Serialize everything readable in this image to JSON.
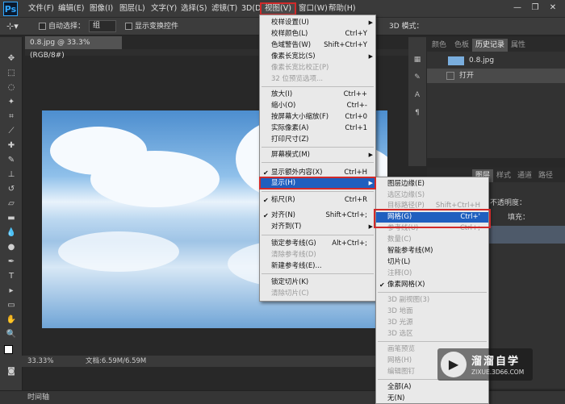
{
  "app": {
    "logo": "Ps"
  },
  "menubar": {
    "items": [
      "文件(F)",
      "编辑(E)",
      "图像(I)",
      "图层(L)",
      "文字(Y)",
      "选择(S)",
      "滤镜(T)",
      "3D(D)",
      "视图(V)",
      "窗口(W)",
      "帮助(H)"
    ]
  },
  "window_controls": {
    "minimize": "—",
    "maximize": "❐",
    "close": "✕"
  },
  "options": {
    "auto_select_label": "自动选择：",
    "auto_select_value": "组",
    "show_transform_label": "显示变换控件",
    "mode_3d_label": "3D 模式："
  },
  "document": {
    "tab_title": "0.8.jpg @ 33.3%(RGB/8#)"
  },
  "status": {
    "zoom": "33.33%",
    "doc_info": "文档:6.59M/6.59M"
  },
  "timeline": {
    "label": "时间轴"
  },
  "right_panel": {
    "top_tabs": [
      "颜色",
      "色板",
      "历史记录",
      "属性"
    ],
    "history": [
      {
        "label": "0.8.jpg"
      },
      {
        "label": "打开"
      }
    ],
    "layer_tabs": [
      "图层",
      "样式",
      "通道",
      "路径"
    ],
    "opacity_label": "不透明度：",
    "fill_label": "填充："
  },
  "view_menu": {
    "items": [
      {
        "label": "校样设置(U)",
        "shortcut": "",
        "submenu": true
      },
      {
        "label": "校样颜色(L)",
        "shortcut": "Ctrl+Y"
      },
      {
        "label": "色域警告(W)",
        "shortcut": "Shift+Ctrl+Y"
      },
      {
        "label": "像素长宽比(S)",
        "shortcut": "",
        "submenu": true
      },
      {
        "label": "像素长宽比校正(P)",
        "shortcut": "",
        "disabled": true
      },
      {
        "label": "32 位预览选项...",
        "shortcut": "",
        "disabled": true
      },
      {
        "label": "放大(I)",
        "shortcut": "Ctrl++"
      },
      {
        "label": "缩小(O)",
        "shortcut": "Ctrl+-"
      },
      {
        "label": "按屏幕大小缩放(F)",
        "shortcut": "Ctrl+0"
      },
      {
        "label": "实际像素(A)",
        "shortcut": "Ctrl+1"
      },
      {
        "label": "打印尺寸(Z)",
        "shortcut": ""
      },
      {
        "label": "屏幕模式(M)",
        "shortcut": "",
        "submenu": true
      },
      {
        "label": "显示额外内容(X)",
        "shortcut": "Ctrl+H",
        "checked": true
      },
      {
        "label": "显示(H)",
        "shortcut": "",
        "submenu": true,
        "highlighted": true
      },
      {
        "label": "标尺(R)",
        "shortcut": "Ctrl+R",
        "checked": true
      },
      {
        "label": "对齐(N)",
        "shortcut": "Shift+Ctrl+;",
        "checked": true
      },
      {
        "label": "对齐到(T)",
        "shortcut": "",
        "submenu": true
      },
      {
        "label": "锁定参考线(G)",
        "shortcut": "Alt+Ctrl+;"
      },
      {
        "label": "清除参考线(D)",
        "shortcut": "",
        "disabled": true
      },
      {
        "label": "新建参考线(E)...",
        "shortcut": ""
      },
      {
        "label": "锁定切片(K)",
        "shortcut": ""
      },
      {
        "label": "清除切片(C)",
        "shortcut": "",
        "disabled": true
      }
    ]
  },
  "show_submenu": {
    "items": [
      {
        "label": "图层边缘(E)",
        "shortcut": ""
      },
      {
        "label": "选区边缘(S)",
        "shortcut": "",
        "disabled": true
      },
      {
        "label": "目标路径(P)",
        "shortcut": "Shift+Ctrl+H",
        "disabled": true
      },
      {
        "label": "网格(G)",
        "shortcut": "Ctrl+'",
        "highlighted": true
      },
      {
        "label": "参考线(U)",
        "shortcut": "Ctrl+;",
        "disabled": true
      },
      {
        "label": "数量(C)",
        "shortcut": "",
        "disabled": true
      },
      {
        "label": "智能参考线(M)",
        "shortcut": ""
      },
      {
        "label": "切片(L)",
        "shortcut": ""
      },
      {
        "label": "注释(O)",
        "shortcut": "",
        "disabled": true
      },
      {
        "label": "像素网格(X)",
        "shortcut": "",
        "checked": true
      },
      {
        "label": "3D 副视图(3)",
        "shortcut": "",
        "disabled": true
      },
      {
        "label": "3D 地面",
        "shortcut": "",
        "disabled": true
      },
      {
        "label": "3D 光源",
        "shortcut": "",
        "disabled": true
      },
      {
        "label": "3D 选区",
        "shortcut": "",
        "disabled": true
      },
      {
        "label": "画笔预览",
        "shortcut": "",
        "disabled": true
      },
      {
        "label": "网格(H)",
        "shortcut": "",
        "disabled": true
      },
      {
        "label": "编辑图钉",
        "shortcut": "",
        "disabled": true
      },
      {
        "label": "全部(A)",
        "shortcut": ""
      },
      {
        "label": "无(N)",
        "shortcut": ""
      }
    ]
  },
  "watermark": {
    "logo": "▶",
    "title": "溜溜自学",
    "url": "ZIXUE.3D66.COM"
  }
}
